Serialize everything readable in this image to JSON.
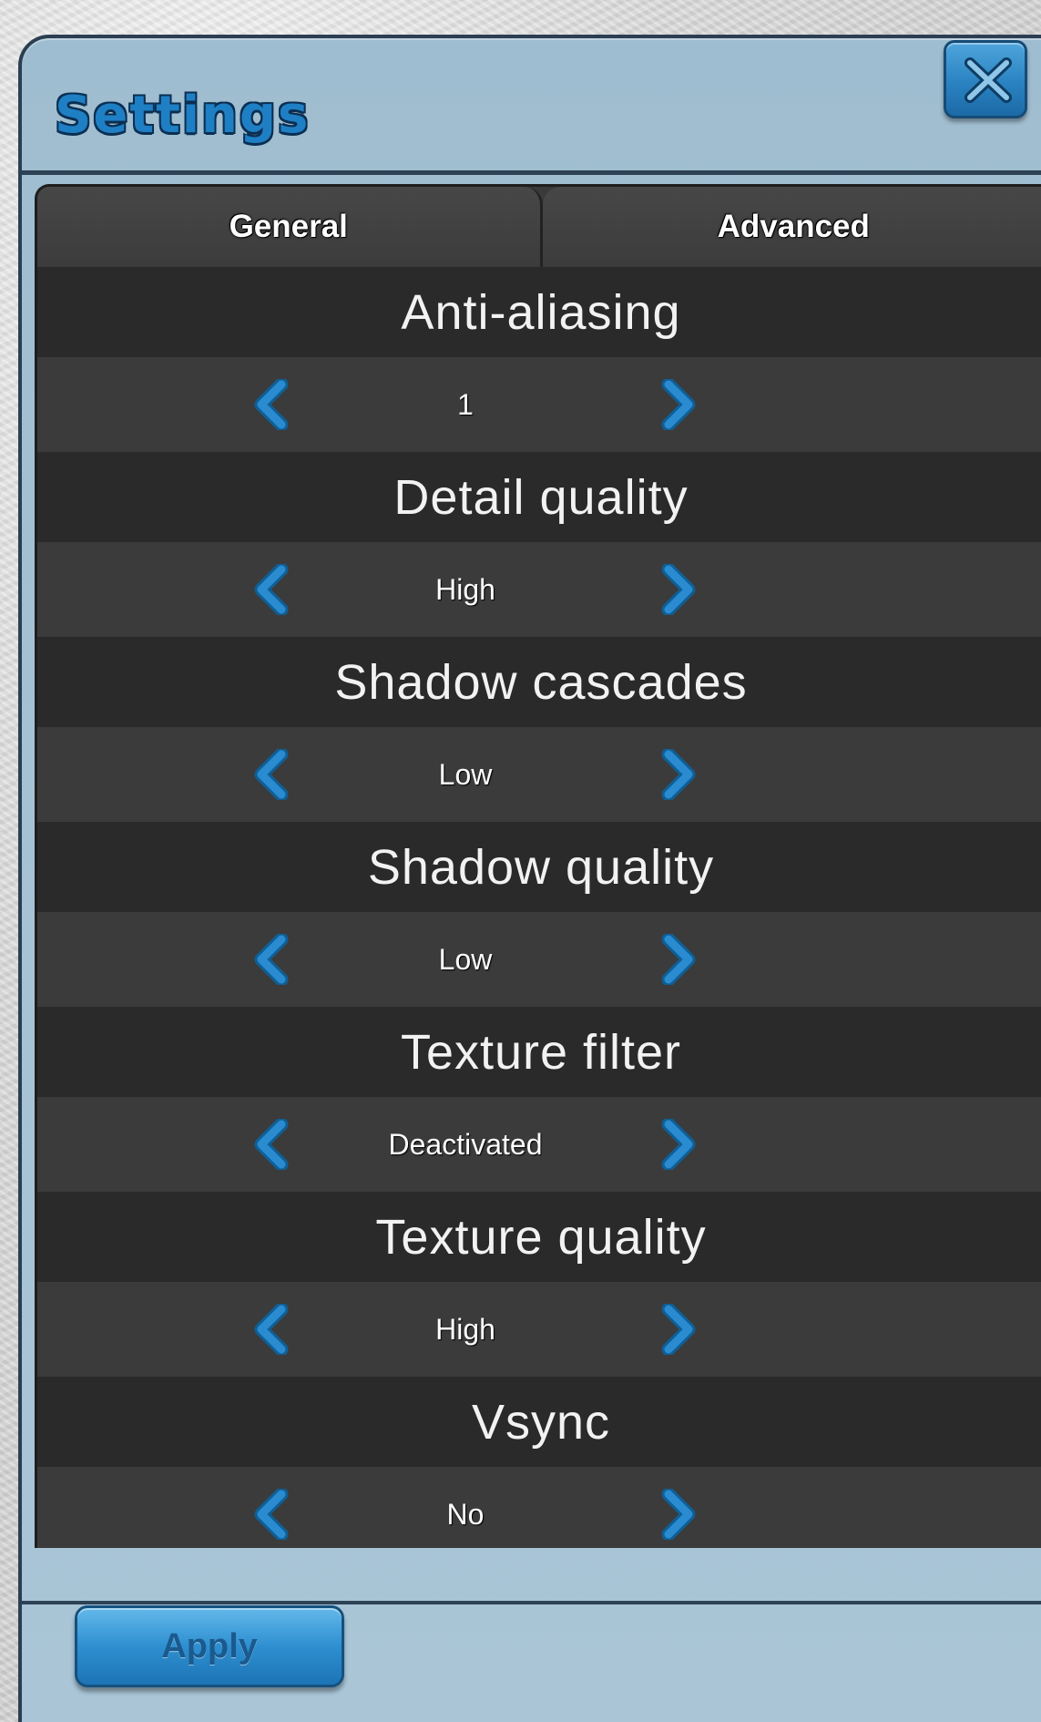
{
  "dialog": {
    "title": "Settings",
    "close_icon": "close-x-icon"
  },
  "tabs": [
    {
      "label": "General"
    },
    {
      "label": "Advanced"
    }
  ],
  "settings": [
    {
      "label": "Anti-aliasing",
      "value": "1"
    },
    {
      "label": "Detail quality",
      "value": "High"
    },
    {
      "label": "Shadow cascades",
      "value": "Low"
    },
    {
      "label": "Shadow quality",
      "value": "Low"
    },
    {
      "label": "Texture filter",
      "value": "Deactivated"
    },
    {
      "label": "Texture quality",
      "value": "High"
    },
    {
      "label": "Vsync",
      "value": "No"
    }
  ],
  "footer": {
    "apply_label": "Apply"
  },
  "colors": {
    "accent": "#1f7fc4",
    "dialog_bg": "#a6c3d4",
    "panel_dark": "#2a2a2a",
    "panel_mid": "#3b3b3b",
    "arrow": "#2a8bd0"
  },
  "icons": {
    "prev": "chevron-left-icon",
    "next": "chevron-right-icon"
  }
}
